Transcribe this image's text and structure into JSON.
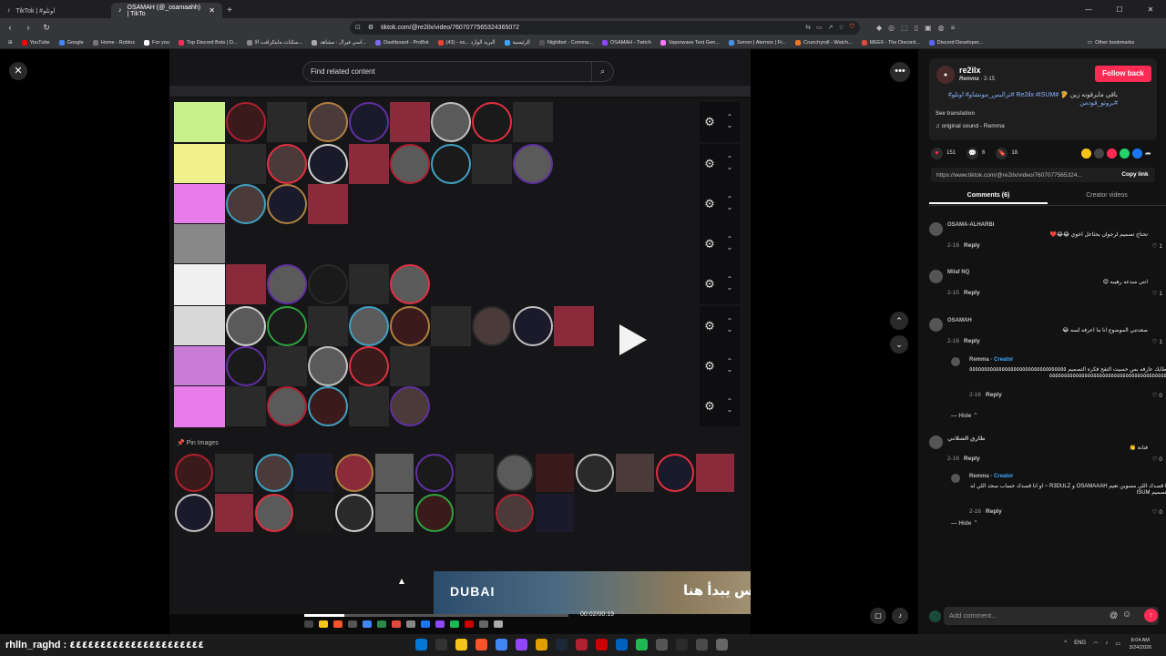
{
  "browser": {
    "tabs": [
      {
        "label": "TikTok | #اوتلو"
      },
      {
        "label": "OSAMAH (@_osamaahh) | TikTo"
      }
    ],
    "url": "tiktok.com/@re2ilx/video/7607077565324365072",
    "bookmarks": [
      {
        "label": "YouTube",
        "color": "#ff0000"
      },
      {
        "label": "Google",
        "color": "#4285f4"
      },
      {
        "label": "Home - Roblox",
        "color": "#777777"
      },
      {
        "label": "For you",
        "color": "#ffffff"
      },
      {
        "label": "Top Discord Bots | D...",
        "color": "#fe2c55"
      },
      {
        "label": "سكنات مايتكرافت الا...",
        "color": "#888888"
      },
      {
        "label": "اسي فيرال - مشاهد...",
        "color": "#aaaaaa"
      },
      {
        "label": "Dashboard - ProBot",
        "color": "#7b68ee"
      },
      {
        "label": "(43) - os... البريد الوارد",
        "color": "#ea4335"
      },
      {
        "label": "الرئيسية",
        "color": "#3ea6ff"
      },
      {
        "label": "Nightbot - Comma...",
        "color": "#555555"
      },
      {
        "label": "OSAMAH - Twitch",
        "color": "#9146ff"
      },
      {
        "label": "Vaporwave Text Gen...",
        "color": "#ff77ff"
      },
      {
        "label": "Server | Aternos | Fr...",
        "color": "#4a90e2"
      },
      {
        "label": "Crunchyroll - Watch...",
        "color": "#f47521"
      },
      {
        "label": "MEE6 - The Discord...",
        "color": "#e0483e"
      },
      {
        "label": "Discord Developer...",
        "color": "#5865f2"
      }
    ],
    "other_bookmarks": "Other bookmarks"
  },
  "video": {
    "search_placeholder": "Find related content",
    "pin_label": "Pin Images",
    "ad_logo": "DUBAI",
    "ad_text": "الحماس يبدأ هنا",
    "time": "00:02/00:19",
    "progress": 0.15
  },
  "post": {
    "username": "re2ilx",
    "display": "Remma",
    "date": "2-15",
    "follow_label": "Follow back",
    "caption_ar": "باقي مايرفونه زين 🦻",
    "caption_tags": "#Re2ilx #ISUM #ترالبس_مونشاو# اوتلو#",
    "caption_tags2": "#بروتو_قودمن",
    "see_translation": "See translation",
    "sound": "original sound - Remma",
    "likes": "151",
    "comments_count": "6",
    "saves": "18",
    "link": "https://www.tiktok.com/@re2ilx/video/7607077565324...",
    "copy_label": "Copy link",
    "tab_comments": "Comments (6)",
    "tab_creator": "Creator videos",
    "comment_placeholder": "Add comment..."
  },
  "comments": [
    {
      "name": "OSAMA-ALHARBI",
      "text": "تحتاج تصميم لرجوان بحثاعل اخوي 😂😂❤️",
      "date": "2-16",
      "reply": "Reply",
      "likes": "1"
    },
    {
      "name": "Milaf NQ",
      "text": "انتي مبدعه رهيبه 😍",
      "date": "2-15",
      "reply": "Reply",
      "likes": "1"
    },
    {
      "name": "OSAMAH",
      "text": "صعدتني الموضوع انا ما اعرفه لسه 😂",
      "date": "2-16",
      "reply": "Reply",
      "likes": "1"
    },
    {
      "name": "Remma",
      "creator": "Creator",
      "text": "مطايك عارفه بس حسيت التقح فكره التصميم ٥٥٥٥٥٥٥٥٥٥٥٥٥٥٥٥٥٥٥٥٥٥٥٥٥٥٥٥٥٥٥٥٥٥٥٥٥٥٥٥٥٥٥٥٥٥٥٥٥٥٥٥٥٥٥٥٥٥٥٥٥٥٥٥٥٥٥٥٥٥٥٥٥٥",
      "date": "2-16",
      "reply": "Reply",
      "likes": "0"
    },
    {
      "name": "طارق الشلاتي",
      "text": "فنانة 👏",
      "date": "2-16",
      "reply": "Reply",
      "likes": "0"
    },
    {
      "name": "Remma",
      "creator": "Creator",
      "text": "انا قصدك اللي مسوين تعيم OSAMAAAH و R3DULZ ~ او انا قصدك حساب سجد اللي له التصميم ISUM",
      "date": "2-16",
      "reply": "Reply",
      "likes": "0"
    }
  ],
  "hide_label": "Hide",
  "taskbar": {
    "user_text": "rhlln_raghd : ٤٤٤٤٤٤٤٤٤٤٤٤٤٤٤٤٤٤٤٤٤٤",
    "lang": "ENG",
    "time": "8:04 AM",
    "date": "3/24/2026"
  },
  "colors": {
    "accent": "#fe2c55",
    "creator": "#3ea6ff",
    "tag": "#8ab4ff"
  }
}
